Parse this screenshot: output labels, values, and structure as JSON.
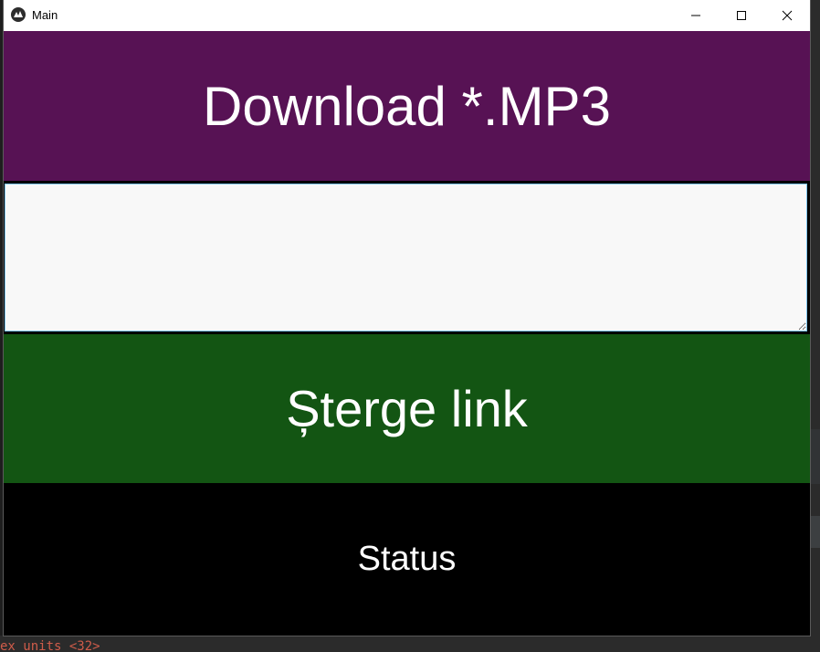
{
  "window": {
    "title": "Main",
    "icon": "kivy-icon",
    "controls": {
      "minimize_icon": "minimize-icon",
      "maximize_icon": "maximize-icon",
      "close_icon": "close-icon"
    }
  },
  "main": {
    "download_label": "Download *.MP3",
    "link_input": {
      "value": "",
      "placeholder": ""
    },
    "clear_label": "Șterge link",
    "status_text": "Status"
  },
  "background": {
    "bottom_code_fragment": "ex_units <32>"
  },
  "colors": {
    "download_button": "#571254",
    "clear_button": "#135513",
    "status_background": "#000000",
    "input_background": "#f8f8f8",
    "input_border": "#7fc6ee",
    "text": "#ffffff"
  }
}
